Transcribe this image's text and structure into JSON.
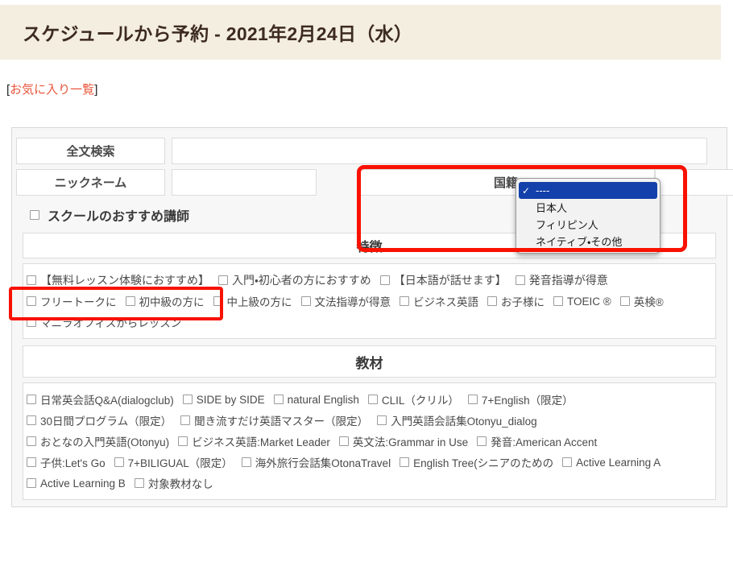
{
  "header": {
    "title": "スケジュールから予約 - 2021年2月24日（水）",
    "banner_color": "#f4eee1",
    "title_color": "#3d2b1f"
  },
  "favorites": {
    "open_bracket": "[",
    "link_label": "お気に入り一覧",
    "close_bracket": "]",
    "link_color": "#e8553a"
  },
  "search_form": {
    "fulltext": {
      "label": "全文検索",
      "value": "",
      "placeholder": ""
    },
    "nickname": {
      "label": "ニックネーム",
      "value": "",
      "placeholder": ""
    },
    "nationality": {
      "label": "国籍",
      "selected_value": "----",
      "caret": "▼",
      "dropdown_open": true,
      "checkmark": "✓",
      "options": [
        {
          "label": "----",
          "selected": true
        },
        {
          "label": "日本人",
          "selected": false
        },
        {
          "label": "フィリピン人",
          "selected": false
        },
        {
          "label": "ネイティブ・その他",
          "selected": false
        }
      ],
      "highlight_color": "#1440ab"
    },
    "school_recommended": {
      "label": "スクールのおすすめ講師",
      "checked": false
    }
  },
  "features_section": {
    "heading": "特徴",
    "rows": [
      [
        {
          "label": "【無料レッスン体験におすすめ】",
          "checked": false
        },
        {
          "label": "入門・初心者の方におすすめ",
          "checked": false
        },
        {
          "label": "【日本語が話せます】",
          "checked": false
        },
        {
          "label": "発音指導が得意",
          "checked": false
        }
      ],
      [
        {
          "label": "フリートークに",
          "checked": false
        },
        {
          "label": "初中級の方に",
          "checked": false
        },
        {
          "label": "中上級の方に",
          "checked": false
        },
        {
          "label": "文法指導が得意",
          "checked": false
        },
        {
          "label": "ビジネス英語",
          "checked": false
        },
        {
          "label": "お子様に",
          "checked": false
        },
        {
          "label": "TOEIC ®",
          "checked": false
        },
        {
          "label": "英検®",
          "checked": false
        }
      ],
      [
        {
          "label": "マニラオフィスからレッスン",
          "checked": false
        }
      ]
    ]
  },
  "materials_section": {
    "heading": "教材",
    "rows": [
      [
        {
          "label": "日常英会話Q&A(dialogclub)",
          "checked": false
        },
        {
          "label": "SIDE by SIDE",
          "checked": false
        },
        {
          "label": "natural English",
          "checked": false
        },
        {
          "label": "CLIL（クリル）",
          "checked": false
        },
        {
          "label": "7+English（限定）",
          "checked": false
        }
      ],
      [
        {
          "label": "30日間プログラム（限定）",
          "checked": false
        },
        {
          "label": "聞き流すだけ英語マスター（限定）",
          "checked": false
        },
        {
          "label": "入門英語会話集Otonyu_dialog",
          "checked": false
        }
      ],
      [
        {
          "label": "おとなの入門英語(Otonyu)",
          "checked": false
        },
        {
          "label": "ビジネス英語:Market Leader",
          "checked": false
        },
        {
          "label": "英文法:Grammar in Use",
          "checked": false
        },
        {
          "label": "発音:American Accent",
          "checked": false
        }
      ],
      [
        {
          "label": "子供:Let's Go",
          "checked": false
        },
        {
          "label": "7+BILIGUAL（限定）",
          "checked": false
        },
        {
          "label": "海外旅行会話集OtonaTravel",
          "checked": false
        },
        {
          "label": "English Tree(シニアのための",
          "checked": false
        },
        {
          "label": "Active Learning A",
          "checked": false
        }
      ],
      [
        {
          "label": "Active Learning B",
          "checked": false
        },
        {
          "label": "対象教材なし",
          "checked": false
        }
      ]
    ]
  },
  "annotations": {
    "color": "#f91100",
    "boxes": [
      {
        "name": "nationality-dropdown-highlight"
      },
      {
        "name": "free-trial-checkbox-highlight"
      }
    ]
  }
}
